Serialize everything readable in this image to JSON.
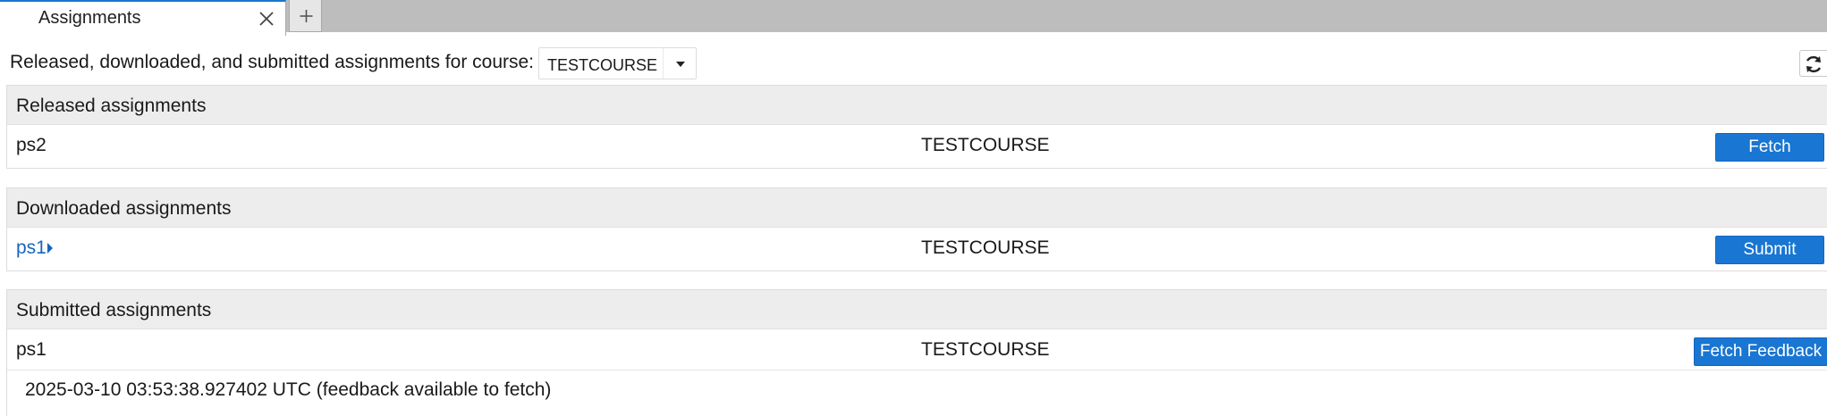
{
  "tabs": [
    {
      "label": "Assignments",
      "close_icon": "close-icon"
    }
  ],
  "new_tab_icon": "plus-icon",
  "toolbar": {
    "text": "Released, downloaded, and submitted assignments for course:",
    "course_selected": "TESTCOURSE",
    "refresh_icon": "refresh-icon"
  },
  "colors": {
    "accent": "#1976d2",
    "link": "#1565c0",
    "section_header_bg": "#ededed",
    "tabbar_bg": "#bdbdbd"
  },
  "released": {
    "title": "Released assignments",
    "rows": [
      {
        "name": "ps2",
        "course": "TESTCOURSE",
        "action": "Fetch"
      }
    ]
  },
  "downloaded": {
    "title": "Downloaded assignments",
    "rows": [
      {
        "name": "ps1",
        "course": "TESTCOURSE",
        "action": "Submit",
        "expand_icon": "caret-right-icon"
      }
    ]
  },
  "submitted": {
    "title": "Submitted assignments",
    "rows": [
      {
        "name": "ps1",
        "course": "TESTCOURSE",
        "action": "Fetch Feedback"
      }
    ],
    "details": [
      "2025-03-10 03:53:38.927402 UTC (feedback available to fetch)"
    ]
  }
}
